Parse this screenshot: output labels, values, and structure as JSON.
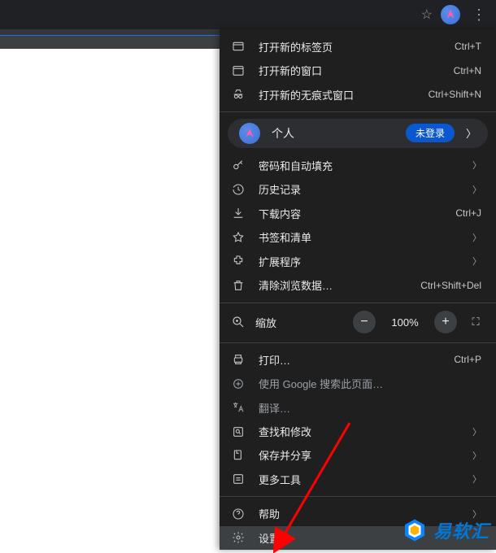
{
  "menu": {
    "new_tab": {
      "label": "打开新的标签页",
      "shortcut": "Ctrl+T"
    },
    "new_window": {
      "label": "打开新的窗口",
      "shortcut": "Ctrl+N"
    },
    "incognito": {
      "label": "打开新的无痕式窗口",
      "shortcut": "Ctrl+Shift+N"
    },
    "profile": {
      "label": "个人",
      "badge": "未登录"
    },
    "passwords": {
      "label": "密码和自动填充"
    },
    "history": {
      "label": "历史记录"
    },
    "downloads": {
      "label": "下载内容",
      "shortcut": "Ctrl+J"
    },
    "bookmarks": {
      "label": "书签和清单"
    },
    "extensions": {
      "label": "扩展程序"
    },
    "clear_data": {
      "label": "清除浏览数据…",
      "shortcut": "Ctrl+Shift+Del"
    },
    "zoom": {
      "label": "缩放",
      "value": "100%"
    },
    "print": {
      "label": "打印…",
      "shortcut": "Ctrl+P"
    },
    "google_search": {
      "label": "使用 Google 搜索此页面…"
    },
    "translate": {
      "label": "翻译…"
    },
    "find_edit": {
      "label": "查找和修改"
    },
    "save_share": {
      "label": "保存并分享"
    },
    "more_tools": {
      "label": "更多工具"
    },
    "help": {
      "label": "帮助"
    },
    "settings": {
      "label": "设置"
    }
  },
  "watermark": {
    "text": "易软汇"
  }
}
